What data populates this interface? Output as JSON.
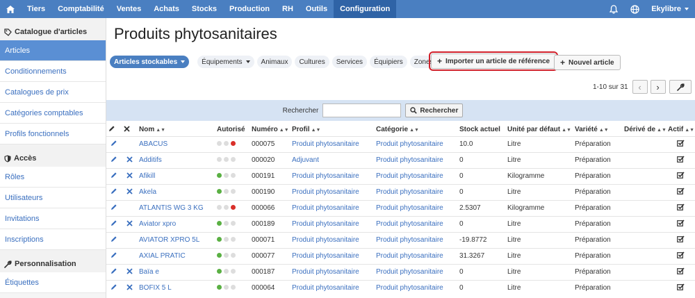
{
  "nav": {
    "items": [
      "Tiers",
      "Comptabilité",
      "Ventes",
      "Achats",
      "Stocks",
      "Production",
      "RH",
      "Outils",
      "Configuration"
    ],
    "active": "Configuration",
    "user": "Ekylibre"
  },
  "sidebar": {
    "sections": [
      {
        "title": "Catalogue d'articles",
        "items": [
          "Articles",
          "Conditionnements",
          "Catalogues de prix",
          "Catégories comptables",
          "Profils fonctionnels"
        ]
      },
      {
        "title": "Accès",
        "items": [
          "Rôles",
          "Utilisateurs",
          "Invitations",
          "Inscriptions"
        ]
      },
      {
        "title": "Personnalisation",
        "items": [
          "Étiquettes"
        ]
      }
    ],
    "active": "Articles"
  },
  "page": {
    "title": "Produits phytosanitaires"
  },
  "filters": {
    "active": "Articles stockables",
    "dropdown": "Équipements",
    "chips": [
      "Animaux",
      "Cultures",
      "Services",
      "Équipiers",
      "Zones"
    ]
  },
  "actions": {
    "import_label": "Importer un article de référence",
    "new_label": "Nouvel article"
  },
  "pager": {
    "count": "1-10 sur 31"
  },
  "search": {
    "label": "Rechercher",
    "button": "Rechercher",
    "value": ""
  },
  "table": {
    "headers": {
      "nom": "Nom",
      "autorise": "Autorisé",
      "numero": "Numéro",
      "profil": "Profil",
      "categorie": "Catégorie",
      "stock": "Stock actuel",
      "unite": "Unité par défaut",
      "variete": "Variété",
      "derive": "Dérivé de",
      "actif": "Actif"
    },
    "rows": [
      {
        "nom": "ABACUS",
        "deletable": false,
        "autorise": "red",
        "numero": "000075",
        "profil": "Produit phytosanitaire",
        "categorie": "Produit phytosanitaire",
        "stock": "10.0",
        "unite": "Litre",
        "variete": "Préparation"
      },
      {
        "nom": "Additifs",
        "deletable": true,
        "autorise": "none",
        "numero": "000020",
        "profil": "Adjuvant",
        "categorie": "Produit phytosanitaire",
        "stock": "0",
        "unite": "Litre",
        "variete": "Préparation"
      },
      {
        "nom": "Afikill",
        "deletable": true,
        "autorise": "green",
        "numero": "000191",
        "profil": "Produit phytosanitaire",
        "categorie": "Produit phytosanitaire",
        "stock": "0",
        "unite": "Kilogramme",
        "variete": "Préparation"
      },
      {
        "nom": "Akela",
        "deletable": true,
        "autorise": "green",
        "numero": "000190",
        "profil": "Produit phytosanitaire",
        "categorie": "Produit phytosanitaire",
        "stock": "0",
        "unite": "Litre",
        "variete": "Préparation"
      },
      {
        "nom": "ATLANTIS WG 3 KG",
        "deletable": false,
        "autorise": "red",
        "numero": "000066",
        "profil": "Produit phytosanitaire",
        "categorie": "Produit phytosanitaire",
        "stock": "2.5307",
        "unite": "Kilogramme",
        "variete": "Préparation"
      },
      {
        "nom": "Aviator xpro",
        "deletable": true,
        "autorise": "green",
        "numero": "000189",
        "profil": "Produit phytosanitaire",
        "categorie": "Produit phytosanitaire",
        "stock": "0",
        "unite": "Litre",
        "variete": "Préparation"
      },
      {
        "nom": "AVIATOR XPRO 5L",
        "deletable": false,
        "autorise": "green",
        "numero": "000071",
        "profil": "Produit phytosanitaire",
        "categorie": "Produit phytosanitaire",
        "stock": "-19.8772",
        "unite": "Litre",
        "variete": "Préparation"
      },
      {
        "nom": "AXIAL PRATIC",
        "deletable": false,
        "autorise": "green",
        "numero": "000077",
        "profil": "Produit phytosanitaire",
        "categorie": "Produit phytosanitaire",
        "stock": "31.3267",
        "unite": "Litre",
        "variete": "Préparation"
      },
      {
        "nom": "Baïa e",
        "deletable": true,
        "autorise": "green",
        "numero": "000187",
        "profil": "Produit phytosanitaire",
        "categorie": "Produit phytosanitaire",
        "stock": "0",
        "unite": "Litre",
        "variete": "Préparation"
      },
      {
        "nom": "BOFIX 5 L",
        "deletable": true,
        "autorise": "green",
        "numero": "000064",
        "profil": "Produit phytosanitaire",
        "categorie": "Produit phytosanitaire",
        "stock": "0",
        "unite": "Litre",
        "variete": "Préparation"
      }
    ]
  },
  "colors": {
    "nav": "#4a7fc1",
    "nav_active": "#2f63a6",
    "link": "#3a6fbf",
    "green": "#5ab043",
    "red": "#d9302a",
    "highlight": "#d0202a"
  }
}
